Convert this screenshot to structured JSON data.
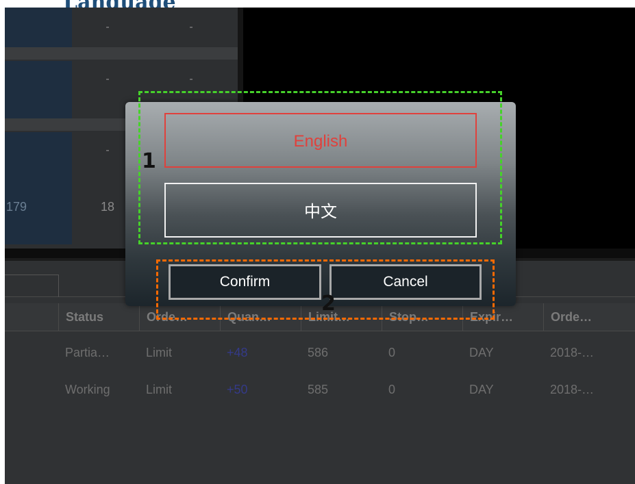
{
  "heading": {
    "text": "Language"
  },
  "upper_grid": {
    "rows": [
      {
        "name": "",
        "col1": "-",
        "col2": "-"
      },
      {
        "name": "",
        "col1": "-",
        "col2": "-"
      },
      {
        "name": "",
        "col1": "-",
        "col2": ""
      },
      {
        "name": "179",
        "col1": "18",
        "col2": ""
      }
    ]
  },
  "orders": {
    "columns": [
      "Status",
      "Orde…",
      "Quan…",
      "Limit…",
      "Stop…",
      "Expir…",
      "Orde…"
    ],
    "rows": [
      [
        "Partia…",
        "Limit",
        "+48",
        "586",
        "0",
        "DAY",
        "2018-…"
      ],
      [
        "Working",
        "Limit",
        "+50",
        "585",
        "0",
        "DAY",
        "2018-…"
      ]
    ]
  },
  "dialog": {
    "english_label": "English",
    "chinese_label": "中文",
    "confirm_label": "Confirm",
    "cancel_label": "Cancel"
  },
  "annotations": {
    "box1_label": "1",
    "box2_label": "2"
  },
  "colors": {
    "selected_border": "#e0413c",
    "annotation_green": "#46d22a",
    "annotation_orange": "#ff6a00",
    "quantity_text": "#343a88"
  }
}
